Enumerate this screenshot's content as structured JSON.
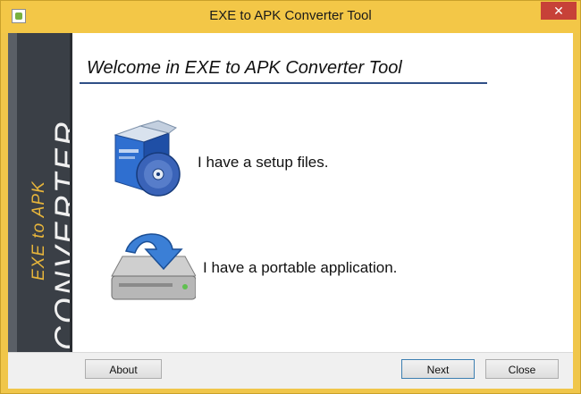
{
  "window": {
    "title": "EXE to APK Converter Tool",
    "close_glyph": "✕"
  },
  "banner": {
    "top_text": "EXE to APK",
    "bottom_text": "CONVERTER"
  },
  "main": {
    "heading": "Welcome in EXE to APK Converter Tool",
    "options": [
      {
        "label": "I have a setup files.",
        "icon": "setup-package-icon"
      },
      {
        "label": "I have a portable application.",
        "icon": "drive-download-icon"
      }
    ]
  },
  "footer": {
    "about_label": "About",
    "next_label": "Next",
    "close_label": "Close"
  },
  "colors": {
    "title_bar": "#f3c747",
    "banner_bg": "#3a3f46",
    "banner_accent": "#e7b53b",
    "heading_rule": "#2f4f86",
    "close_button": "#c74138"
  }
}
